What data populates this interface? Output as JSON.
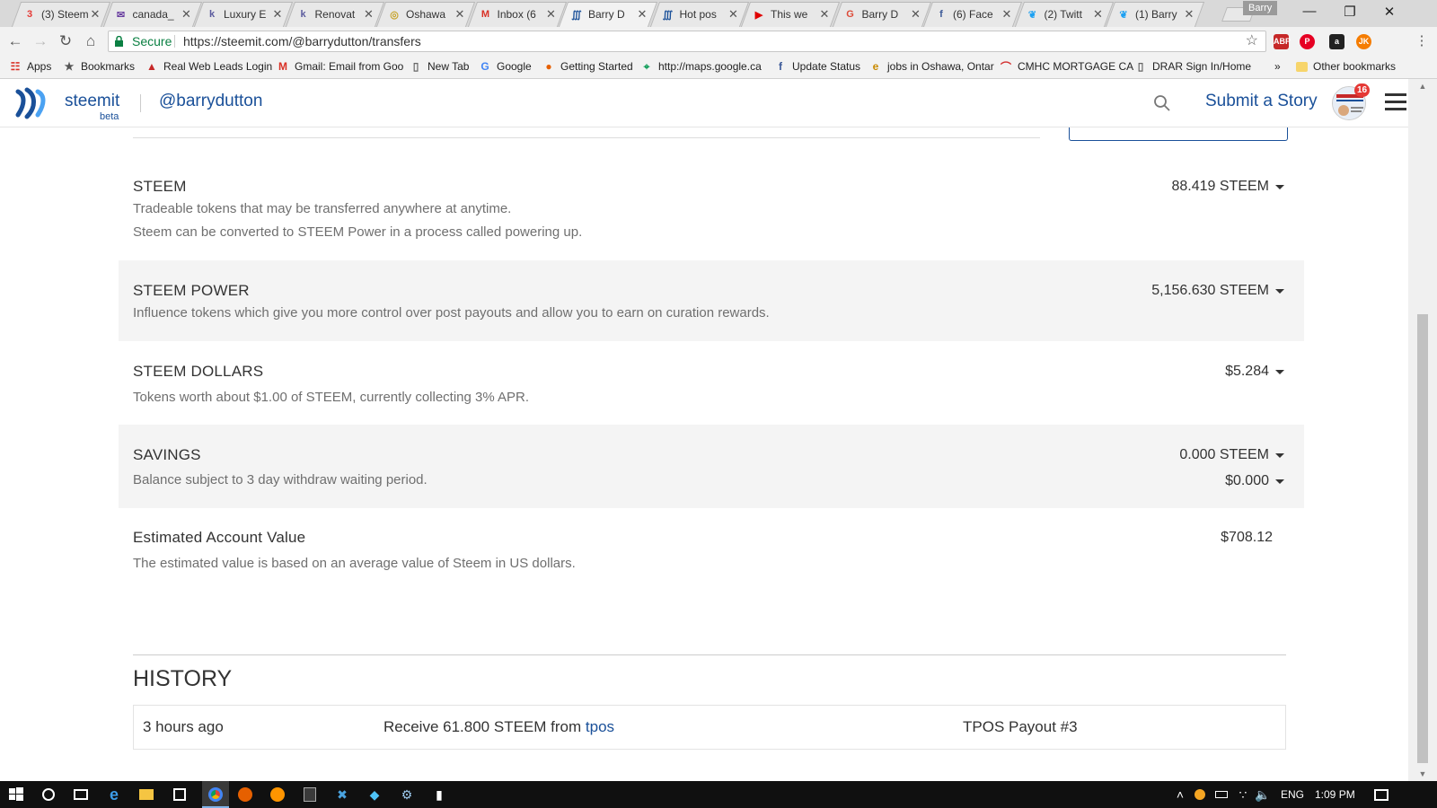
{
  "browser": {
    "tabs": [
      {
        "label": "(3) Steem",
        "icon": "steemit-notification-icon",
        "color": "#e53935"
      },
      {
        "label": "canada_",
        "icon": "mail-icon",
        "color": "#6a3fa0"
      },
      {
        "label": "Luxury E",
        "icon": "k-icon",
        "color": "#5b5b9e"
      },
      {
        "label": "Renovat",
        "icon": "k-icon",
        "color": "#5b5b9e"
      },
      {
        "label": "Oshawa",
        "icon": "globe-icon",
        "color": "#c7a32a"
      },
      {
        "label": "Inbox (6",
        "icon": "gmail-icon",
        "color": "#d93025"
      },
      {
        "label": "Barry D",
        "icon": "steemit-icon",
        "color": "#1a5099"
      },
      {
        "label": "Hot pos",
        "icon": "steemit-icon",
        "color": "#1a5099"
      },
      {
        "label": "This we",
        "icon": "youtube-icon",
        "color": "#e00000"
      },
      {
        "label": "Barry D",
        "icon": "google-plus-icon",
        "color": "#dd4b39"
      },
      {
        "label": "(6) Face",
        "icon": "facebook-icon",
        "color": "#3b5998"
      },
      {
        "label": "(2) Twitt",
        "icon": "twitter-icon",
        "color": "#1da1f2"
      },
      {
        "label": "(1) Barry",
        "icon": "twitter-icon",
        "color": "#1da1f2"
      }
    ],
    "active_tab": 6,
    "profile_name": "Barry",
    "secure_label": "Secure",
    "url": "https://steemit.com/@barrydutton/transfers",
    "bookmarks": [
      {
        "label": "Apps",
        "icon": "apps-grid-icon"
      },
      {
        "label": "Bookmarks",
        "icon": "star-icon"
      },
      {
        "label": "Real Web Leads Login",
        "icon": "real-web-leads-icon"
      },
      {
        "label": "Gmail: Email from Goo",
        "icon": "gmail-icon"
      },
      {
        "label": "New Tab",
        "icon": "page-icon"
      },
      {
        "label": "Google",
        "icon": "google-icon"
      },
      {
        "label": "Getting Started",
        "icon": "firefox-icon"
      },
      {
        "label": "http://maps.google.ca",
        "icon": "maps-icon"
      },
      {
        "label": "Update Status",
        "icon": "facebook-icon"
      },
      {
        "label": "jobs in Oshawa, Ontar",
        "icon": "e-icon"
      },
      {
        "label": "CMHC MORTGAGE CA",
        "icon": "cmhc-icon"
      },
      {
        "label": "DRAR Sign In/Home",
        "icon": "page-icon"
      }
    ],
    "bookmarks_overflow": "»",
    "other_bookmarks": "Other bookmarks"
  },
  "site": {
    "brand": "steemit",
    "beta": "beta",
    "username": "@barrydutton",
    "submit_label": "Submit a Story",
    "notification_count": "16",
    "accent_color": "#1a5099"
  },
  "wallet": {
    "rows": [
      {
        "title": "STEEM",
        "desc": [
          "Tradeable tokens that may be transferred anywhere at anytime.",
          "Steem can be converted to STEEM Power in a process called powering up."
        ],
        "value": "88.419 STEEM"
      },
      {
        "title": "STEEM POWER",
        "desc": [
          "Influence tokens which give you more control over post payouts and allow you to earn on curation rewards."
        ],
        "value": "5,156.630 STEEM"
      },
      {
        "title": "STEEM DOLLARS",
        "desc": [
          "Tokens worth about $1.00 of STEEM, currently collecting 3% APR."
        ],
        "value": "$5.284"
      },
      {
        "title": "SAVINGS",
        "desc": [
          "Balance subject to 3 day withdraw waiting period."
        ],
        "value": "0.000 STEEM",
        "value2": "$0.000"
      },
      {
        "title": "Estimated Account Value",
        "desc": [
          "The estimated value is based on an average value of Steem in US dollars."
        ],
        "value": "$708.12"
      }
    ]
  },
  "history": {
    "title": "HISTORY",
    "items": [
      {
        "time": "3 hours ago",
        "action_prefix": "Receive 61.800 STEEM from",
        "from": "tpos",
        "memo": "TPOS Payout #3"
      }
    ]
  },
  "taskbar": {
    "language": "ENG",
    "time": "1:09 PM"
  }
}
